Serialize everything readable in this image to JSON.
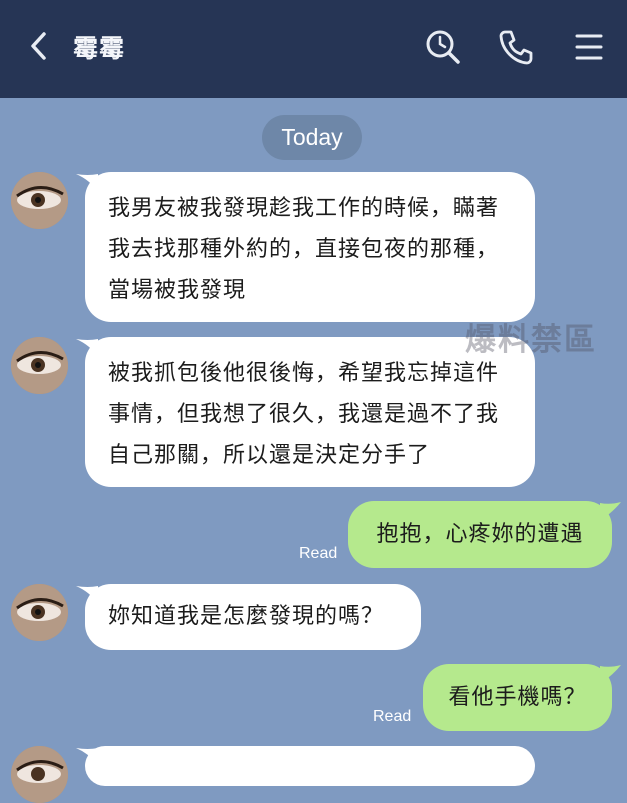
{
  "header": {
    "title": "霉霉",
    "back_icon": "chevron-left-icon",
    "search_icon": "search-clock-icon",
    "call_icon": "phone-icon",
    "menu_icon": "hamburger-menu-icon",
    "background": "#263555"
  },
  "chat": {
    "date_label": "Today",
    "background": "#7f9ac1",
    "messages": [
      {
        "sender": "contact",
        "text": "我男友被我發現趁我工作的時候，瞞著我去找那種外約的，直接包夜的那種，當場被我發現"
      },
      {
        "sender": "contact",
        "text": "被我抓包後他很後悔，希望我忘掉這件事情，但我想了很久，我還是過不了我自己那關，所以還是決定分手了"
      },
      {
        "sender": "me",
        "text": "抱抱，心疼妳的遭遇",
        "status": "Read"
      },
      {
        "sender": "contact",
        "text": "妳知道我是怎麼發現的嗎？"
      },
      {
        "sender": "me",
        "text": "看他手機嗎？",
        "status": "Read"
      }
    ],
    "outgoing_color": "#b5e98d",
    "incoming_color": "#ffffff"
  },
  "watermark": "爆料禁區"
}
